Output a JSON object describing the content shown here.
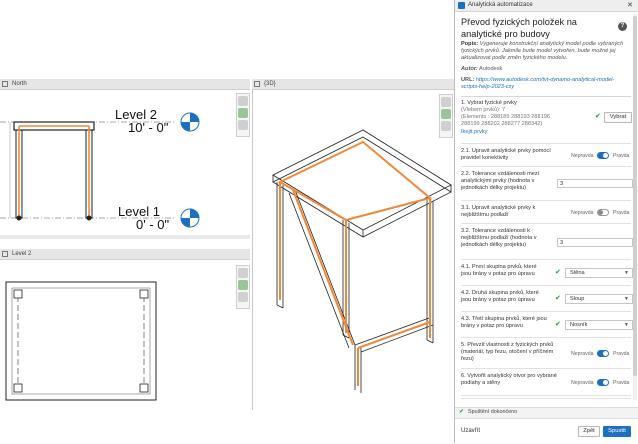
{
  "views": {
    "elevation_tab": "North",
    "view3d_tab": "{3D}",
    "plan_tab": "Level 2",
    "level2": {
      "name": "Level 2",
      "elevation": "10' - 0\""
    },
    "level1": {
      "name": "Level 1",
      "elevation": "0' - 0\""
    }
  },
  "panel": {
    "window_title": "Analytická automatizace",
    "help_icon": "?",
    "more_icon": "⋮",
    "close_icon": "✕",
    "heading": "Převod fyzických položek na analytické pro budovy",
    "description_label": "Popis:",
    "description": "Vygeneruje konstrukční analytický model podle vybraných fyzických prvků. Jakmile bude model vytvořen, bude možné jej aktualizovat podle změn fyzického modelu.",
    "author_label": "Autor:",
    "author": "Autodesk",
    "url_label": "URL:",
    "url": "https://www.autodesk.com/tvt-dynamo-analytical-model-scripts-help-2023-csy",
    "step1": {
      "title": "1. Vybrat fyzické prvky",
      "count_text": "(Vlebem prvků): 7",
      "elements": "(Elements : 288189 288193 288196 288199 288202 288277 288342)",
      "link": "Ikejit prvky",
      "button": "Vybrat"
    },
    "steps": [
      {
        "label": "2.1. Upravit analytické prvky pomocí pravidel konektivity",
        "type": "toggle",
        "off_label": "Nepravda",
        "on_label": "Pravda",
        "on": true
      },
      {
        "label": "2.2. Tolerance vzdálenosti mezi analytickými prvky (hodnota v jednotkách délky projektu)",
        "type": "number",
        "value": "3"
      },
      {
        "label": "3.1. Upravit analytické prvky k nejbližšímu podlaží",
        "type": "toggle",
        "off_label": "Nepravda",
        "on_label": "Pravda",
        "on": false
      },
      {
        "label": "3.2. Tolerance vzdálenosti k nejbližšímu podlaží (hodnota v jednotkách délky projektu)",
        "type": "number",
        "value": "3"
      },
      {
        "label": "4.1. První skupina prvků, které jsou brány v potaz pro úpravu",
        "type": "dropdown",
        "value": "Stěna"
      },
      {
        "label": "4.2. Druhá skupina prvků, které jsou brány v potaz pro úpravu",
        "type": "dropdown",
        "value": "Sloup"
      },
      {
        "label": "4.3. Třetí skupina prvků, které jsou brány v potaz pro úpravu",
        "type": "dropdown",
        "value": "Nosník"
      },
      {
        "label": "5. Převzít vlastnosti z fyzických prvků (materiál, typ řezu, otočení v příčném řezu)",
        "type": "toggle",
        "off_label": "Nepravda",
        "on_label": "Pravda",
        "on": true
      },
      {
        "label": "6. Vytvořit analytický otvor pro vybrané podlahy a stěny",
        "type": "toggle",
        "off_label": "Nepravda",
        "on_label": "Pravda",
        "on": true
      }
    ],
    "status": "Spuštění dokončeno",
    "footer_left": "Uzavřít",
    "back_button": "Zpět",
    "run_button": "Spustit"
  },
  "colors": {
    "accent": "#1e6fc0",
    "analytical": "#f0883a",
    "level_blue": "#1e6fc0",
    "success": "#1c9a3b"
  }
}
